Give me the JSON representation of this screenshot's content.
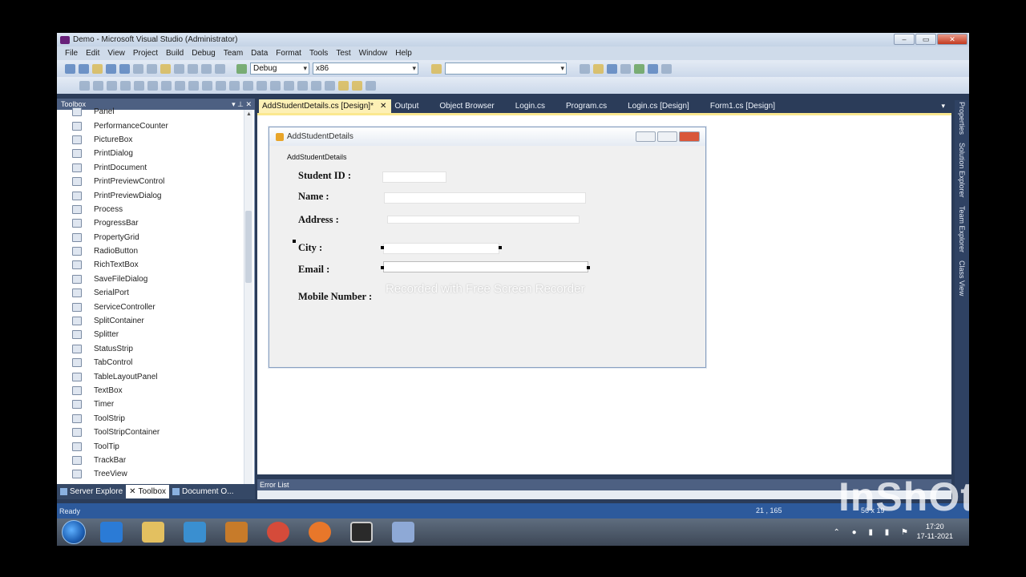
{
  "window": {
    "title": "Demo - Microsoft Visual Studio (Administrator)",
    "controls": [
      "–",
      "▭",
      "✕"
    ]
  },
  "menu": [
    "File",
    "Edit",
    "View",
    "Project",
    "Build",
    "Debug",
    "Team",
    "Data",
    "Format",
    "Tools",
    "Test",
    "Window",
    "Help"
  ],
  "toolbar": {
    "config": "Debug",
    "platform": "x86",
    "search": ""
  },
  "toolbox": {
    "title": "Toolbox",
    "pins": "▾ ⊥ ✕",
    "items": [
      "Panel",
      "PerformanceCounter",
      "PictureBox",
      "PrintDialog",
      "PrintDocument",
      "PrintPreviewControl",
      "PrintPreviewDialog",
      "Process",
      "ProgressBar",
      "PropertyGrid",
      "RadioButton",
      "RichTextBox",
      "SaveFileDialog",
      "SerialPort",
      "ServiceController",
      "SplitContainer",
      "Splitter",
      "StatusStrip",
      "TabControl",
      "TableLayoutPanel",
      "TextBox",
      "Timer",
      "ToolStrip",
      "ToolStripContainer",
      "ToolTip",
      "TrackBar",
      "TreeView"
    ],
    "bottom_tabs": [
      "Server Explore",
      "Toolbox",
      "Document O..."
    ]
  },
  "doc_tabs": [
    "AddStudentDetails.cs [Design]*",
    "Output",
    "Object Browser",
    "Login.cs",
    "Program.cs",
    "Login.cs [Design]",
    "Form1.cs [Design]"
  ],
  "form": {
    "title": "AddStudentDetails",
    "menu_label": "AddStudentDetails",
    "labels": {
      "student_id": "Student ID :",
      "name": "Name :",
      "address": "Address :",
      "city": "City :",
      "email": "Email :",
      "mobile": "Mobile Number :"
    },
    "watermark": "Recorded with Free Screen Recorder"
  },
  "error_list": {
    "title": "Error List"
  },
  "right_dock": [
    "Properties",
    "Solution Explorer",
    "Team Explorer",
    "Class View"
  ],
  "status": {
    "text": "Ready",
    "position": "21 , 165",
    "size": "56 x 19"
  },
  "overlay": {
    "brand": "InShOt"
  },
  "taskbar": {
    "time": "17:20",
    "date": "17-11-2021"
  }
}
